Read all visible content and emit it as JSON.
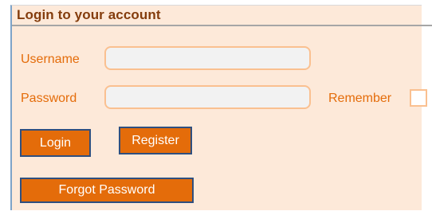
{
  "form": {
    "title": "Login to your account",
    "username_label": "Username",
    "username_value": "",
    "password_label": "Password",
    "password_value": "",
    "remember_label": "Remember",
    "remember_checked": false,
    "login_label": "Login",
    "register_label": "Register",
    "forgot_label": "Forgot Password"
  },
  "colors": {
    "panel_background": "#fde9d9",
    "accent_orange": "#e46c0a",
    "title_brown": "#843c0c",
    "field_border": "#fac090",
    "button_border": "#2f4f7f"
  }
}
